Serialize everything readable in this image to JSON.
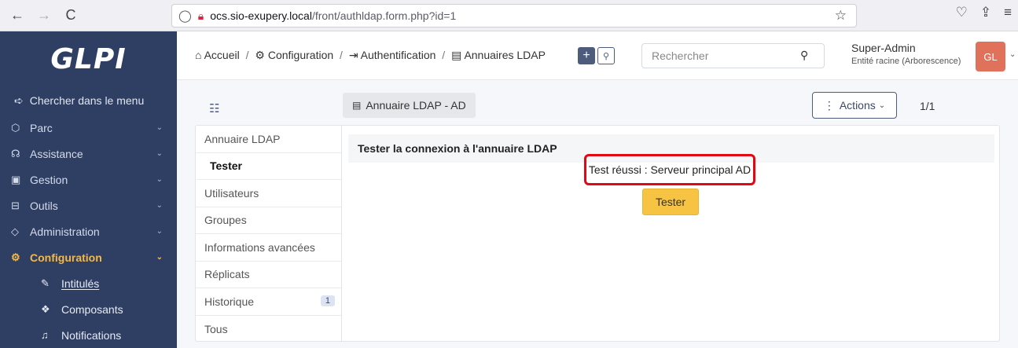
{
  "browser": {
    "back": "←",
    "forward": "→",
    "reload": "C",
    "url_host": "ocs.sio-exupery.local",
    "url_path": "/front/authldap.form.php?id=1"
  },
  "sidebar": {
    "logo": "GLPI",
    "search_label": "Chercher dans le menu",
    "items": [
      {
        "label": "Parc",
        "icon": "cube-icon"
      },
      {
        "label": "Assistance",
        "icon": "headset-icon"
      },
      {
        "label": "Gestion",
        "icon": "wallet-icon"
      },
      {
        "label": "Outils",
        "icon": "briefcase-icon"
      },
      {
        "label": "Administration",
        "icon": "shield-icon"
      },
      {
        "label": "Configuration",
        "icon": "gear-icon",
        "active": true
      }
    ],
    "subitems": [
      {
        "label": "Intitulés",
        "icon": "edit-icon"
      },
      {
        "label": "Composants",
        "icon": "components-icon"
      },
      {
        "label": "Notifications",
        "icon": "bell-icon"
      }
    ]
  },
  "header": {
    "breadcrumb": [
      "Accueil",
      "Configuration",
      "Authentification",
      "Annuaires LDAP"
    ],
    "search_placeholder": "Rechercher",
    "user_name": "Super-Admin",
    "user_entity": "Entité racine (Arborescence)",
    "avatar_initials": "GL"
  },
  "content": {
    "item_title": "Annuaire LDAP - AD",
    "actions_label": "Actions",
    "pager": "1/1",
    "tabs": [
      {
        "label": "Annuaire LDAP"
      },
      {
        "label": "Tester",
        "active": true
      },
      {
        "label": "Utilisateurs"
      },
      {
        "label": "Groupes"
      },
      {
        "label": "Informations avancées"
      },
      {
        "label": "Réplicats"
      },
      {
        "label": "Historique",
        "badge": "1"
      },
      {
        "label": "Tous"
      }
    ],
    "form_title": "Tester la connexion à l'annuaire LDAP",
    "result_text": "Test réussi : Serveur principal AD",
    "test_button": "Tester"
  },
  "colors": {
    "sidebar_bg": "#2f3f64",
    "active_menu": "#f2b94a",
    "highlight_box": "#e30613",
    "test_button": "#f6c343",
    "avatar": "#e0715a"
  }
}
